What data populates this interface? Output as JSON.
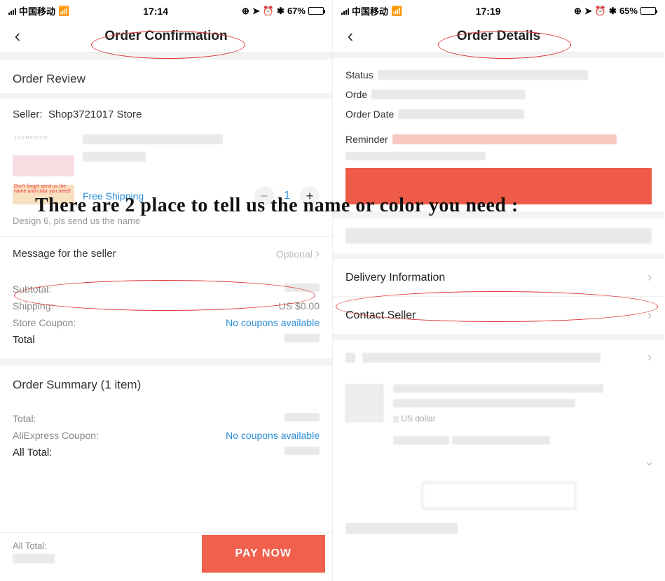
{
  "overlay_caption": "There are 2 place to tell us the name or color you need :",
  "left": {
    "status": {
      "carrier": "中国移动",
      "time": "17:14",
      "battery_pct": "67%"
    },
    "nav_title": "Order Confirmation",
    "order_review_title": "Order Review",
    "seller_label": "Seller:",
    "seller_name": "Shop3721017 Store",
    "product": {
      "shipping_text": "Free Shipping",
      "quantity": "1",
      "variant_note": "Design 6, pls send us the name",
      "thumb_brand": "JOYRESIDE",
      "thumb_reminder": "Don't forget send us the name and color you need!"
    },
    "msg_seller": {
      "label": "Message for the seller",
      "placeholder": "Optional"
    },
    "calc": {
      "subtotal_label": "Subtotal:",
      "shipping_label": "Shipping:",
      "shipping_value": "US $0.00",
      "coupon_label": "Store Coupon:",
      "coupon_value": "No coupons available",
      "total_label": "Total"
    },
    "summary": {
      "title": "Order Summary (1 item)",
      "total_label": "Total:",
      "ali_coupon_label": "AliExpress Coupon:",
      "ali_coupon_value": "No coupons available",
      "all_total_label": "All Total:"
    },
    "bottom": {
      "all_total_label": "All Total:",
      "pay_label": "PAY NOW"
    }
  },
  "right": {
    "status": {
      "carrier": "中国移动",
      "time": "17:19",
      "battery_pct": "65%"
    },
    "nav_title": "Order Details",
    "fields": {
      "status_label": "Status",
      "order_label": "Orde",
      "order_date_label": "Order Date",
      "reminder_label": "Reminder"
    },
    "delivery_label": "Delivery Information",
    "contact_label": "Contact Seller",
    "currency_hint": "US dollar"
  }
}
